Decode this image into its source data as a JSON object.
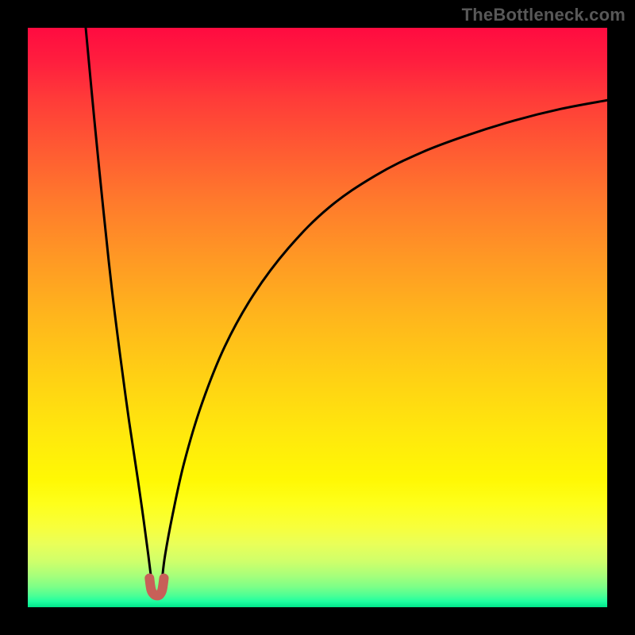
{
  "watermark": "TheBottleneck.com",
  "chart_data": {
    "type": "line",
    "title": "",
    "xlabel": "",
    "ylabel": "",
    "xlim": [
      0,
      100
    ],
    "ylim": [
      0,
      100
    ],
    "grid": false,
    "colors": {
      "gradient_top": "#ff0b40",
      "gradient_mid": "#ffe80d",
      "gradient_bottom": "#00e58a",
      "curve": "#000000",
      "marker": "#c86058"
    },
    "series": [
      {
        "name": "left-branch",
        "x": [
          10.0,
          11.5,
          13.0,
          14.5,
          16.0,
          17.5,
          19.0,
          20.0,
          20.8,
          21.3
        ],
        "y": [
          100,
          84,
          69,
          55,
          43,
          32,
          22,
          15,
          9,
          5
        ]
      },
      {
        "name": "right-branch",
        "x": [
          23.2,
          23.7,
          25.0,
          27.0,
          30.0,
          34.0,
          39.0,
          45.0,
          52.0,
          60.0,
          68.0,
          76.0,
          84.0,
          92.0,
          100.0
        ],
        "y": [
          5,
          9,
          16,
          25,
          35,
          45,
          54,
          62,
          69,
          74.5,
          78.5,
          81.5,
          84,
          86,
          87.5
        ]
      },
      {
        "name": "valley-marker",
        "x": [
          21.0,
          21.3,
          21.8,
          22.3,
          22.8,
          23.2,
          23.5
        ],
        "y": [
          5.0,
          3.0,
          2.2,
          2.0,
          2.2,
          3.0,
          5.0
        ]
      }
    ],
    "minimum": {
      "x": 22.3,
      "y": 2.0
    }
  }
}
